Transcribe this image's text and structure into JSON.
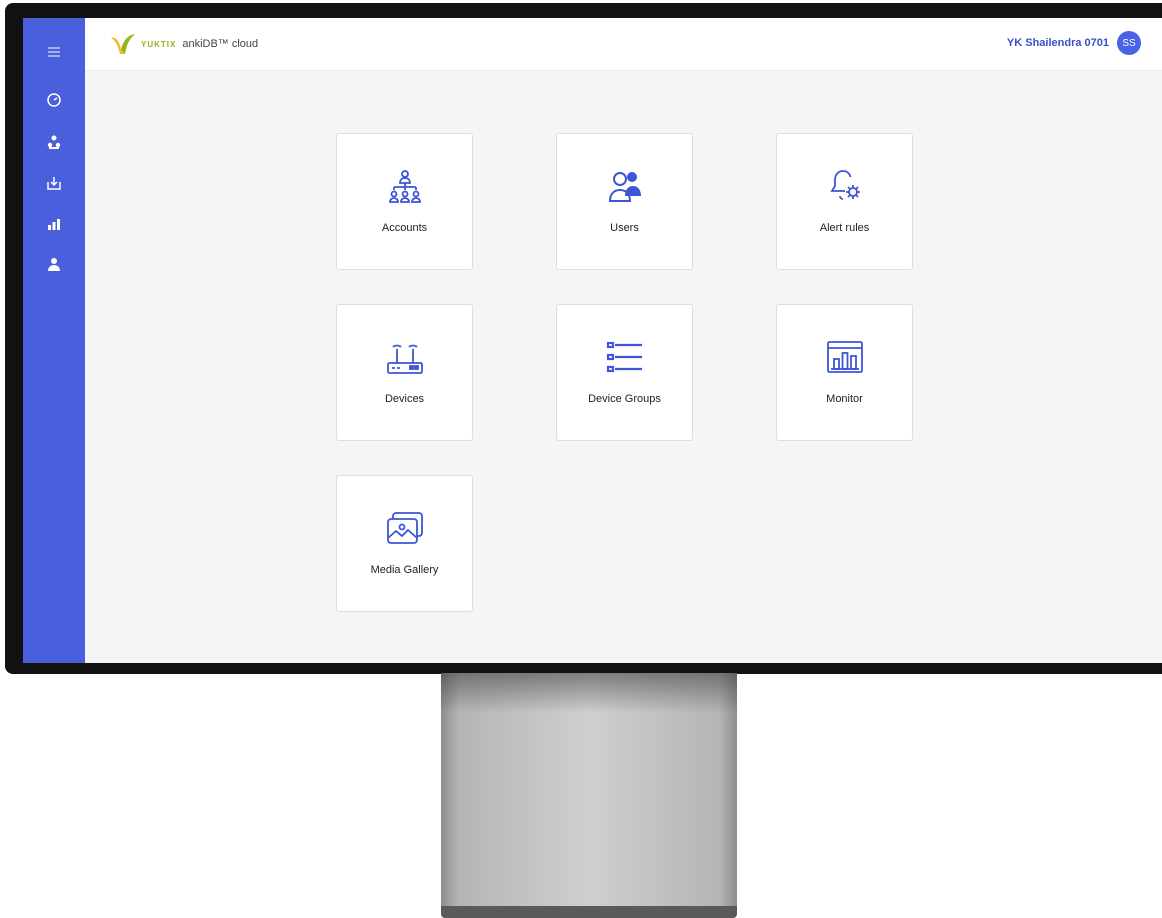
{
  "header": {
    "brand": "YUKTIX",
    "product": "ankiDB™ cloud",
    "user_name": "YK Shailendra 0701",
    "avatar_initials": "SS"
  },
  "sidebar": {
    "items": [
      {
        "icon": "menu-icon"
      },
      {
        "icon": "dashboard-icon"
      },
      {
        "icon": "accounts-icon"
      },
      {
        "icon": "download-icon"
      },
      {
        "icon": "analytics-icon"
      },
      {
        "icon": "user-icon"
      }
    ]
  },
  "tiles": [
    {
      "label": "Accounts",
      "icon": "accounts-hierarchy-icon"
    },
    {
      "label": "Users",
      "icon": "users-icon"
    },
    {
      "label": "Alert rules",
      "icon": "bell-gear-icon"
    },
    {
      "label": "Devices",
      "icon": "router-icon"
    },
    {
      "label": "Device Groups",
      "icon": "list-icon"
    },
    {
      "label": "Monitor",
      "icon": "monitor-chart-icon"
    },
    {
      "label": "Media Gallery",
      "icon": "photos-icon"
    }
  ],
  "colors": {
    "accent": "#4a5fdc",
    "icon": "#3d55d6",
    "brand_green": "#8bb31d"
  }
}
